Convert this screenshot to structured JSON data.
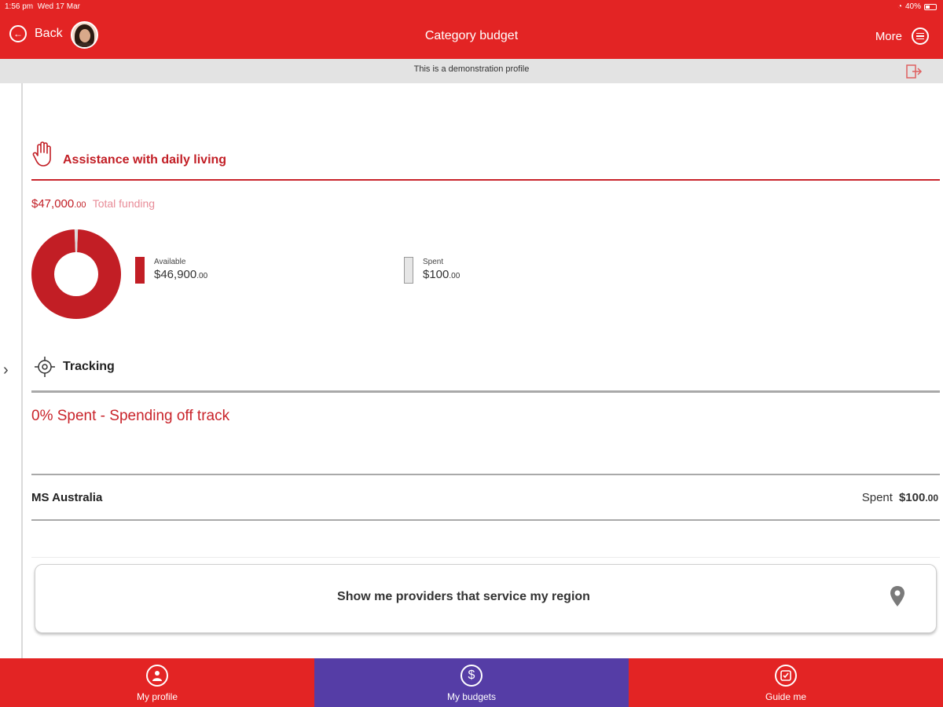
{
  "status_bar": {
    "time": "1:56 pm",
    "date": "Wed 17 Mar",
    "battery": "40%"
  },
  "nav": {
    "back_label": "Back",
    "title": "Category budget",
    "more_label": "More"
  },
  "banner": {
    "text": "This is a demonstration profile"
  },
  "category": {
    "title": "Assistance with daily living",
    "total_funding": {
      "dollars": "$47,000",
      "cents": ".00",
      "label": "Total funding"
    },
    "available": {
      "label": "Available",
      "dollars": "$46,900",
      "cents": ".00",
      "value": 46900
    },
    "spent": {
      "label": "Spent",
      "dollars": "$100",
      "cents": ".00",
      "value": 100
    }
  },
  "tracking": {
    "title": "Tracking",
    "status": "0% Spent - Spending off track"
  },
  "providers": [
    {
      "name": "MS Australia",
      "spent_label": "Spent",
      "dollars": "$100",
      "cents": ".00"
    }
  ],
  "region_button": {
    "label": "Show me providers that service my region"
  },
  "tabs": [
    {
      "label": "My profile"
    },
    {
      "label": "My budgets"
    },
    {
      "label": "Guide me"
    }
  ],
  "colors": {
    "brand_red": "#e32424",
    "accent_red": "#c21e25",
    "active_tab": "#553da6",
    "spent_grey": "#e6e6e6"
  }
}
